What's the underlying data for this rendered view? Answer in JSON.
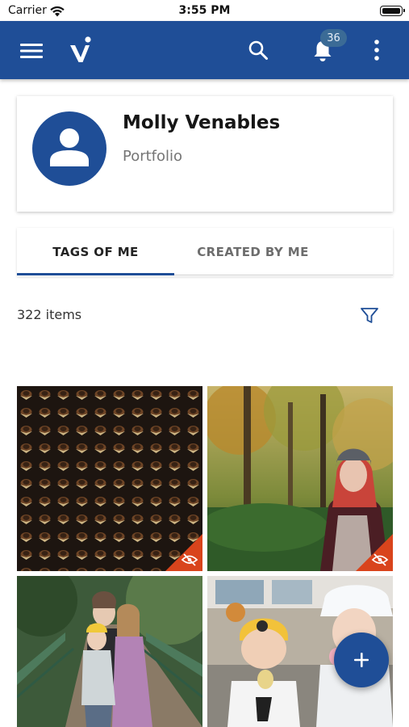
{
  "status_bar": {
    "carrier": "Carrier",
    "time": "3:55 PM"
  },
  "app_bar": {
    "icons": [
      "menu-icon",
      "app-logo",
      "search-icon",
      "bell-icon",
      "more-vertical-icon"
    ],
    "notification_count": "36",
    "color": "#1f4e97"
  },
  "profile": {
    "name": "Molly Venables",
    "subtitle": "Portfolio",
    "avatar_icon": "person-icon"
  },
  "tabs": [
    {
      "label": "TAGS OF ME",
      "selected": true
    },
    {
      "label": "CREATED BY ME",
      "selected": false
    }
  ],
  "list": {
    "count_label": "322 items",
    "filter_icon": "filter-icon"
  },
  "photos": [
    {
      "subject": "graduation-caps-crowd",
      "hidden_flag": true,
      "flag_icon": "eye-off-icon"
    },
    {
      "subject": "autumn-forest-portrait",
      "hidden_flag": true,
      "flag_icon": "eye-off-icon"
    },
    {
      "subject": "family-on-bridge",
      "hidden_flag": false
    },
    {
      "subject": "kids-with-ice-cream",
      "hidden_flag": false
    }
  ],
  "fab": {
    "icon": "plus-icon"
  },
  "colors": {
    "accent": "#1f4e97",
    "badge": "#3b6b96",
    "hidden_flag": "#d9441c"
  }
}
